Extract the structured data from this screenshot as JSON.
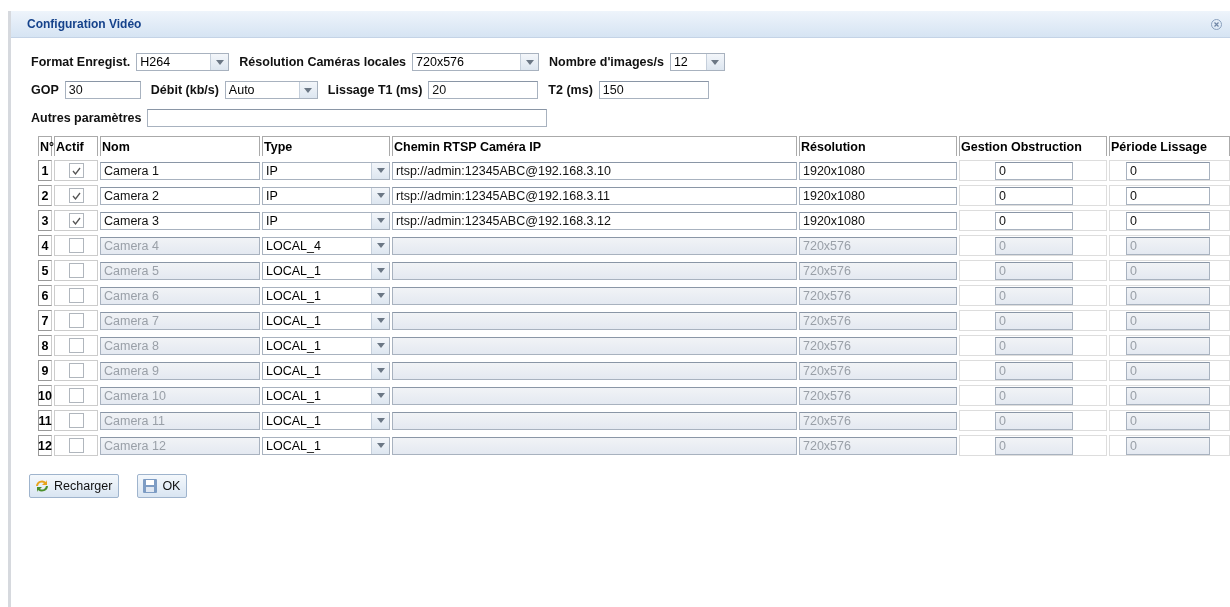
{
  "window": {
    "title": "Configuration Vidéo"
  },
  "settings_row_1": [
    {
      "label": "Format Enregist.",
      "value": "H264",
      "kind": "select"
    },
    {
      "label": "Résolution Caméras locales",
      "value": "720x576",
      "kind": "select"
    },
    {
      "label": "Nombre d'images/s",
      "value": "12",
      "kind": "select"
    }
  ],
  "settings_row_2": [
    {
      "label": "GOP",
      "value": "30",
      "kind": "input"
    },
    {
      "label": "Débit (kb/s)",
      "value": "Auto",
      "kind": "select"
    },
    {
      "label": "Lissage T1 (ms)",
      "value": "20",
      "kind": "input"
    },
    {
      "label": "T2 (ms)",
      "value": "150",
      "kind": "input"
    }
  ],
  "other_params": {
    "label": "Autres paramètres"
  },
  "table": {
    "columns": [
      "N°",
      "Actif",
      "Nom",
      "Type",
      "Chemin RTSP Caméra IP",
      "Résolution",
      "Gestion Obstruction",
      "Période Lissage"
    ],
    "rows": [
      {
        "number": "1",
        "checked": true,
        "name": "Camera 1",
        "type": "IP",
        "path": "rtsp://admin:12345ABC@192.168.3.10",
        "resolution": "1920x1080",
        "obstruction": "0",
        "smoothing": "0"
      },
      {
        "number": "2",
        "checked": true,
        "name": "Camera 2",
        "type": "IP",
        "path": "rtsp://admin:12345ABC@192.168.3.11",
        "resolution": "1920x1080",
        "obstruction": "0",
        "smoothing": "0"
      },
      {
        "number": "3",
        "checked": true,
        "name": "Camera 3",
        "type": "IP",
        "path": "rtsp://admin:12345ABC@192.168.3.12",
        "resolution": "1920x1080",
        "obstruction": "0",
        "smoothing": "0"
      },
      {
        "number": "4",
        "checked": false,
        "name": "Camera 4",
        "type": "LOCAL_4",
        "path": "",
        "resolution": "720x576",
        "obstruction": "0",
        "smoothing": "0"
      },
      {
        "number": "5",
        "checked": false,
        "name": "Camera 5",
        "type": "LOCAL_1",
        "path": "",
        "resolution": "720x576",
        "obstruction": "0",
        "smoothing": "0"
      },
      {
        "number": "6",
        "checked": false,
        "name": "Camera 6",
        "type": "LOCAL_1",
        "path": "",
        "resolution": "720x576",
        "obstruction": "0",
        "smoothing": "0"
      },
      {
        "number": "7",
        "checked": false,
        "name": "Camera 7",
        "type": "LOCAL_1",
        "path": "",
        "resolution": "720x576",
        "obstruction": "0",
        "smoothing": "0"
      },
      {
        "number": "8",
        "checked": false,
        "name": "Camera 8",
        "type": "LOCAL_1",
        "path": "",
        "resolution": "720x576",
        "obstruction": "0",
        "smoothing": "0"
      },
      {
        "number": "9",
        "checked": false,
        "name": "Camera 9",
        "type": "LOCAL_1",
        "path": "",
        "resolution": "720x576",
        "obstruction": "0",
        "smoothing": "0"
      },
      {
        "number": "10",
        "checked": false,
        "name": "Camera 10",
        "type": "LOCAL_1",
        "path": "",
        "resolution": "720x576",
        "obstruction": "0",
        "smoothing": "0"
      },
      {
        "number": "11",
        "checked": false,
        "name": "Camera 11",
        "type": "LOCAL_1",
        "path": "",
        "resolution": "720x576",
        "obstruction": "0",
        "smoothing": "0"
      },
      {
        "number": "12",
        "checked": false,
        "name": "Camera 12",
        "type": "LOCAL_1",
        "path": "",
        "resolution": "720x576",
        "obstruction": "0",
        "smoothing": "0"
      }
    ]
  },
  "buttons": [
    {
      "label": "Recharger",
      "kind": "reload"
    },
    {
      "label": "OK",
      "kind": "save"
    }
  ]
}
